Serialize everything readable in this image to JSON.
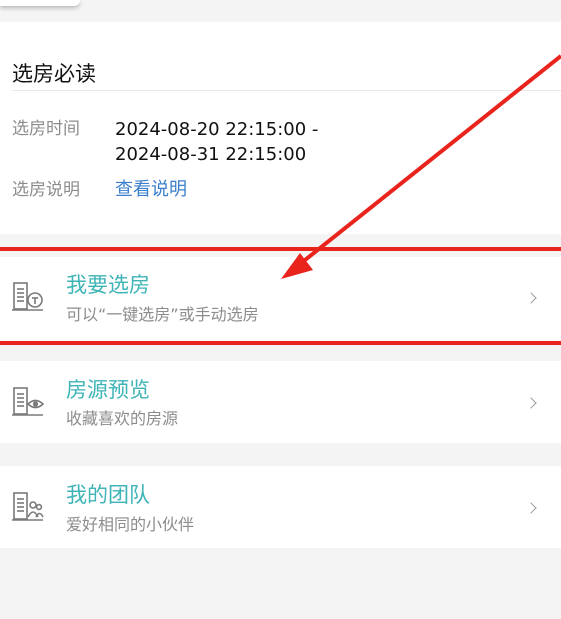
{
  "notice": {
    "title": "选房必读",
    "time_label": "选房时间",
    "time_value": "2024-08-20 22:15:00 - 2024-08-31 22:15:00",
    "desc_label": "选房说明",
    "desc_link": "查看说明"
  },
  "menu": [
    {
      "title": "我要选房",
      "subtitle": "可以“一键选房”或手动选房",
      "icon": "building-key-icon"
    },
    {
      "title": "房源预览",
      "subtitle": "收藏喜欢的房源",
      "icon": "building-eye-icon"
    },
    {
      "title": "我的团队",
      "subtitle": "爱好相同的小伙伴",
      "icon": "building-people-icon"
    }
  ],
  "colors": {
    "accent": "#3eb4b7",
    "link": "#3b7fcc",
    "annotation_red": "#e8241c",
    "muted_text": "#8c8c8c"
  }
}
